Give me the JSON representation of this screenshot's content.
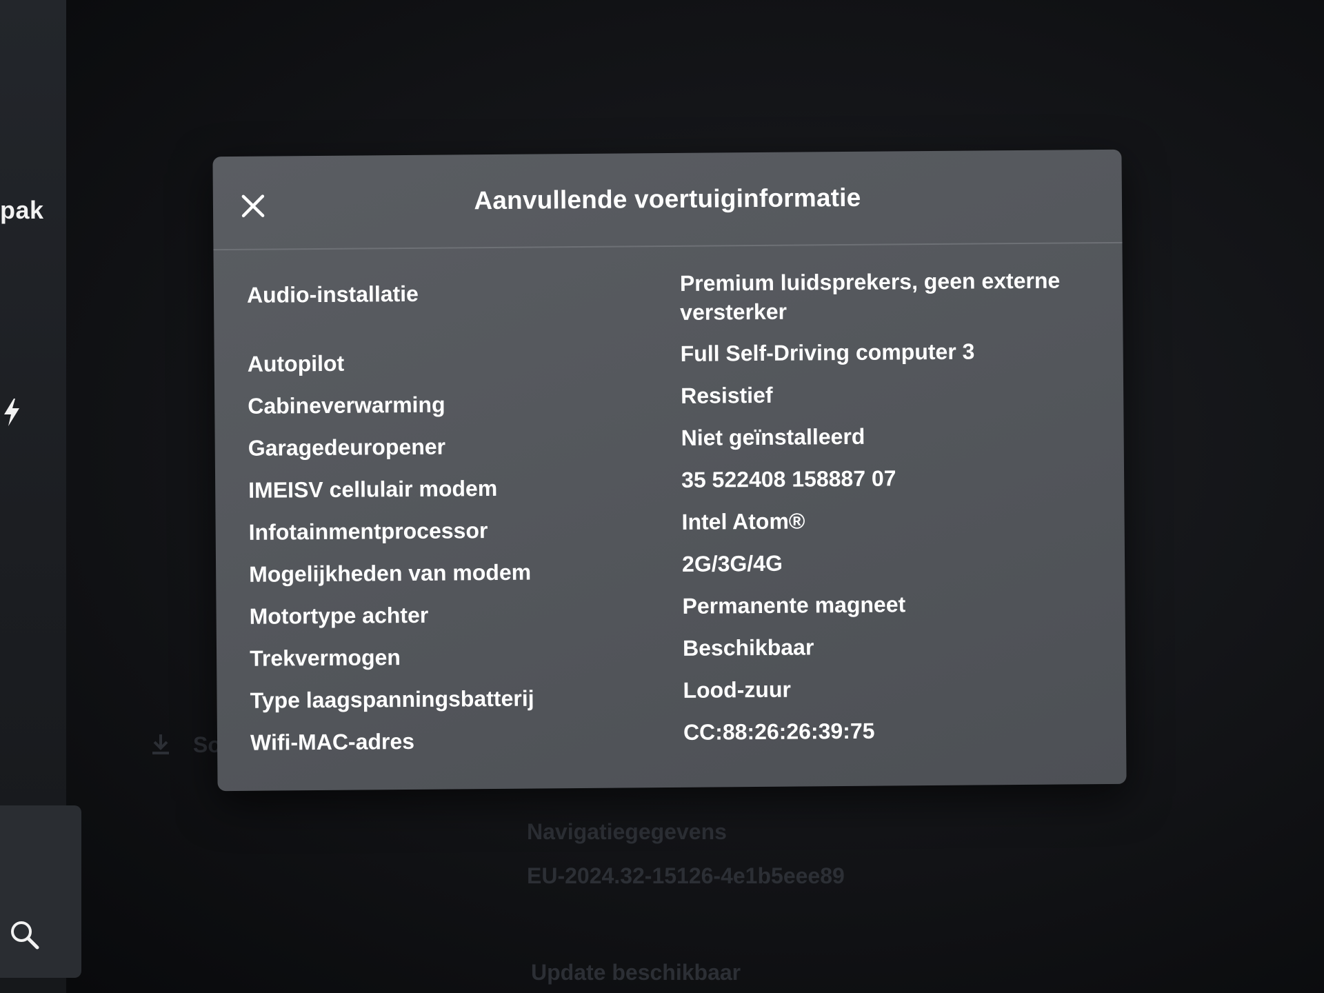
{
  "sidebar": {
    "partial_label": "pak"
  },
  "background": {
    "software_label": "Sof",
    "navigation_label": "Navigatiegegevens",
    "navigation_value": "EU-2024.32-15126-4e1b5eee89",
    "update_label": "Update beschikbaar"
  },
  "dialog": {
    "title": "Aanvullende voertuiginformatie",
    "rows": [
      {
        "label": "Audio-installatie",
        "value": "Premium luidsprekers, geen externe versterker"
      },
      {
        "label": "Autopilot",
        "value": "Full Self-Driving computer 3"
      },
      {
        "label": "Cabineverwarming",
        "value": "Resistief"
      },
      {
        "label": "Garagedeuropener",
        "value": "Niet geïnstalleerd"
      },
      {
        "label": "IMEISV cellulair modem",
        "value": "35 522408 158887 07"
      },
      {
        "label": "Infotainmentprocessor",
        "value": "Intel Atom®"
      },
      {
        "label": "Mogelijkheden van modem",
        "value": "2G/3G/4G"
      },
      {
        "label": "Motortype achter",
        "value": "Permanente magneet"
      },
      {
        "label": "Trekvermogen",
        "value": "Beschikbaar"
      },
      {
        "label": "Type laagspanningsbatterij",
        "value": "Lood-zuur"
      },
      {
        "label": "Wifi-MAC-adres",
        "value": "CC:88:26:26:39:75"
      }
    ]
  },
  "colors": {
    "dialog_bg": "#55585d",
    "text": "#ffffff",
    "screen_bg": "#121316"
  },
  "icons": [
    "close-icon",
    "lightning-bolt-icon",
    "search-icon",
    "download-icon"
  ]
}
